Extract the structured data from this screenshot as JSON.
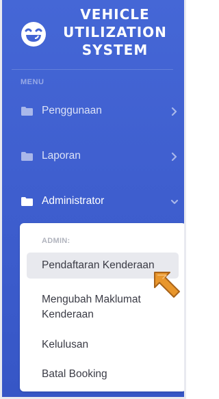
{
  "brand": {
    "title_lines": [
      "VEHICLE",
      "UTILIZATION",
      "SYSTEM"
    ],
    "logo_icon": "laughing-face-icon"
  },
  "menu": {
    "heading": "MENU",
    "items": [
      {
        "label": "Penggunaan",
        "icon": "folder-icon",
        "indicator": "chevron-right-icon"
      },
      {
        "label": "Laporan",
        "icon": "folder-icon",
        "indicator": "chevron-right-icon"
      },
      {
        "label": "Administrator",
        "icon": "folder-icon",
        "indicator": "chevron-down-icon",
        "expanded": true
      }
    ]
  },
  "submenu": {
    "heading": "ADMIN:",
    "items": [
      {
        "label": "Pendaftaran Kenderaan",
        "selected": true
      },
      {
        "label": "Mengubah Maklumat Kenderaan",
        "selected": false
      },
      {
        "label": "Kelulusan",
        "selected": false
      },
      {
        "label": "Batal Booking",
        "selected": false
      }
    ]
  },
  "annotation": {
    "icon": "pointer-arrow-icon",
    "color": "#e8962c"
  },
  "colors": {
    "sidebar": "#4264d4",
    "submenu_bg": "#ffffff",
    "selected_bg": "#e8e9ee"
  }
}
